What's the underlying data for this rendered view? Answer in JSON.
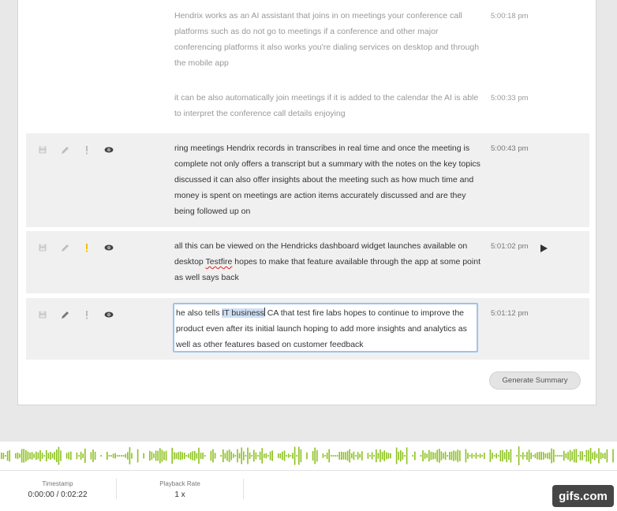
{
  "transcript": [
    {
      "text": "Hendrix works as an AI assistant that joins in on meetings your conference call platforms such as do not go to meetings if a conference and other major conferencing platforms it also works you're dialing services on desktop and through the mobile app",
      "timestamp": "5:00:18 pm"
    },
    {
      "text": "it can be also automatically join meetings if it is added to the calendar the AI is able to interpret the conference call details enjoying",
      "timestamp": "5:00:33 pm"
    },
    {
      "text": "ring meetings Hendrix records in transcribes in real time and once the meeting is complete not only offers a transcript but a summary with the notes on the key topics discussed it can also offer insights about the meeting such as how much time and money is spent on meetings are action items accurately discussed and are they being followed up on",
      "timestamp": "5:00:43 pm"
    },
    {
      "text_before": "all this can be viewed on the Hendricks dashboard widget launches available on desktop ",
      "text_misspelled": "Testfire",
      "text_after": " hopes to make that feature available through the app at some point as well says back",
      "timestamp": "5:01:02 pm",
      "flagged": true
    },
    {
      "text_before": "he also tells ",
      "text_selected": "IT business",
      "text_after": " CA that test fire labs hopes to continue to improve the product even after its initial launch hoping to add more insights and analytics as well as other features based on customer feedback",
      "timestamp": "5:01:12 pm"
    }
  ],
  "actions": {
    "generate_summary": "Generate Summary"
  },
  "footer": {
    "timestamp_label": "Timestamp",
    "timestamp_value": "0:00:00 / 0:02:22",
    "rate_label": "Playback Rate",
    "rate_value": "1 x"
  },
  "watermark": "gifs.com",
  "colors": {
    "waveform": "#8dc21f",
    "flag_active": "#f2c200",
    "selection": "#cfe0f5",
    "edit_border": "#9ec3ee"
  },
  "icons": [
    "save-icon",
    "pencil-icon",
    "flag-icon",
    "eye-icon",
    "play-icon"
  ]
}
